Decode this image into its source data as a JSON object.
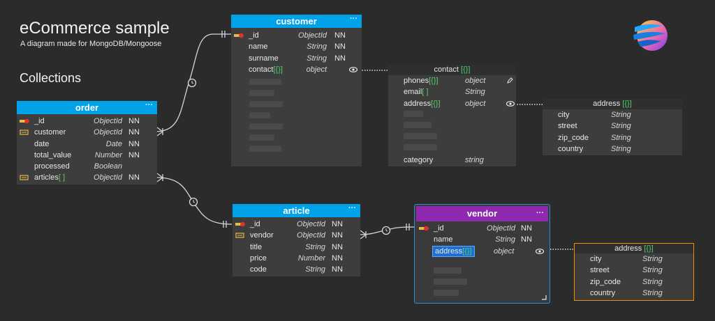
{
  "header": {
    "title": "eCommerce sample",
    "subtitle": "A diagram made for MongoDB/Mongoose",
    "section": "Collections"
  },
  "colors": {
    "background": "#2b2b2b",
    "table_header_blue": "#00a3e8",
    "table_header_purple": "#8f2ab0",
    "selection_blue": "#1f6fd1",
    "highlight_orange": "#f28c00",
    "bracket_green": "#4fd06a",
    "key_red": "#e03030",
    "fk_yellow": "#e8b84a"
  },
  "tables": {
    "customer": {
      "name": "customer",
      "menu": "···",
      "fields": [
        {
          "name": "_id",
          "type": "ObjectId",
          "nn": "NN",
          "icon": "primary-key-icon"
        },
        {
          "name": "name",
          "type": "String",
          "nn": "NN"
        },
        {
          "name": "surname",
          "type": "String",
          "nn": "NN"
        },
        {
          "name": "contact",
          "suffix": "[{}]",
          "type": "object",
          "nn": "",
          "icon": "eye-icon"
        }
      ]
    },
    "order": {
      "name": "order",
      "menu": "···",
      "fields": [
        {
          "name": "_id",
          "type": "ObjectId",
          "nn": "NN",
          "icon": "primary-key-icon"
        },
        {
          "name": "customer",
          "type": "ObjectId",
          "nn": "NN",
          "icon": "foreign-key-icon"
        },
        {
          "name": "date",
          "type": "Date",
          "nn": "NN"
        },
        {
          "name": "total_value",
          "type": "Number",
          "nn": "NN"
        },
        {
          "name": "processed",
          "type": "Boolean",
          "nn": ""
        },
        {
          "name": "articles",
          "suffix": "[ ]",
          "type": "ObjectId",
          "nn": "NN",
          "icon": "foreign-key-icon"
        }
      ]
    },
    "article": {
      "name": "article",
      "menu": "···",
      "fields": [
        {
          "name": "_id",
          "type": "ObjectId",
          "nn": "NN",
          "icon": "primary-key-icon"
        },
        {
          "name": "vendor",
          "type": "ObjectId",
          "nn": "NN",
          "icon": "foreign-key-icon"
        },
        {
          "name": "title",
          "type": "String",
          "nn": "NN"
        },
        {
          "name": "price",
          "type": "Number",
          "nn": "NN"
        },
        {
          "name": "code",
          "type": "String",
          "nn": "NN"
        }
      ]
    },
    "vendor": {
      "name": "vendor",
      "menu": "···",
      "fields": [
        {
          "name": "_id",
          "type": "ObjectId",
          "nn": "NN",
          "icon": "primary-key-icon"
        },
        {
          "name": "name",
          "type": "String",
          "nn": "NN"
        },
        {
          "name": "address",
          "suffix": "[{}]",
          "type": "object",
          "nn": "",
          "icon": "eye-icon"
        }
      ]
    }
  },
  "subdocs": {
    "contact": {
      "name": "contact",
      "suffix": "[{}]",
      "fields": [
        {
          "name": "phones",
          "suffix": "[{}]",
          "type": "object"
        },
        {
          "name": "email",
          "suffix": "[ ]",
          "type": "String"
        },
        {
          "name": "address",
          "suffix": "[{}]",
          "type": "object"
        }
      ],
      "extra": {
        "name": "category",
        "type": "string"
      }
    },
    "customer_address": {
      "name": "address",
      "suffix": "[{}]",
      "fields": [
        {
          "name": "city",
          "type": "String"
        },
        {
          "name": "street",
          "type": "String"
        },
        {
          "name": "zip_code",
          "type": "String"
        },
        {
          "name": "country",
          "type": "String"
        }
      ]
    },
    "vendor_address": {
      "name": "address",
      "suffix": "[{}]",
      "fields": [
        {
          "name": "city",
          "type": "String"
        },
        {
          "name": "street",
          "type": "String"
        },
        {
          "name": "zip_code",
          "type": "String"
        },
        {
          "name": "country",
          "type": "String"
        }
      ]
    }
  }
}
